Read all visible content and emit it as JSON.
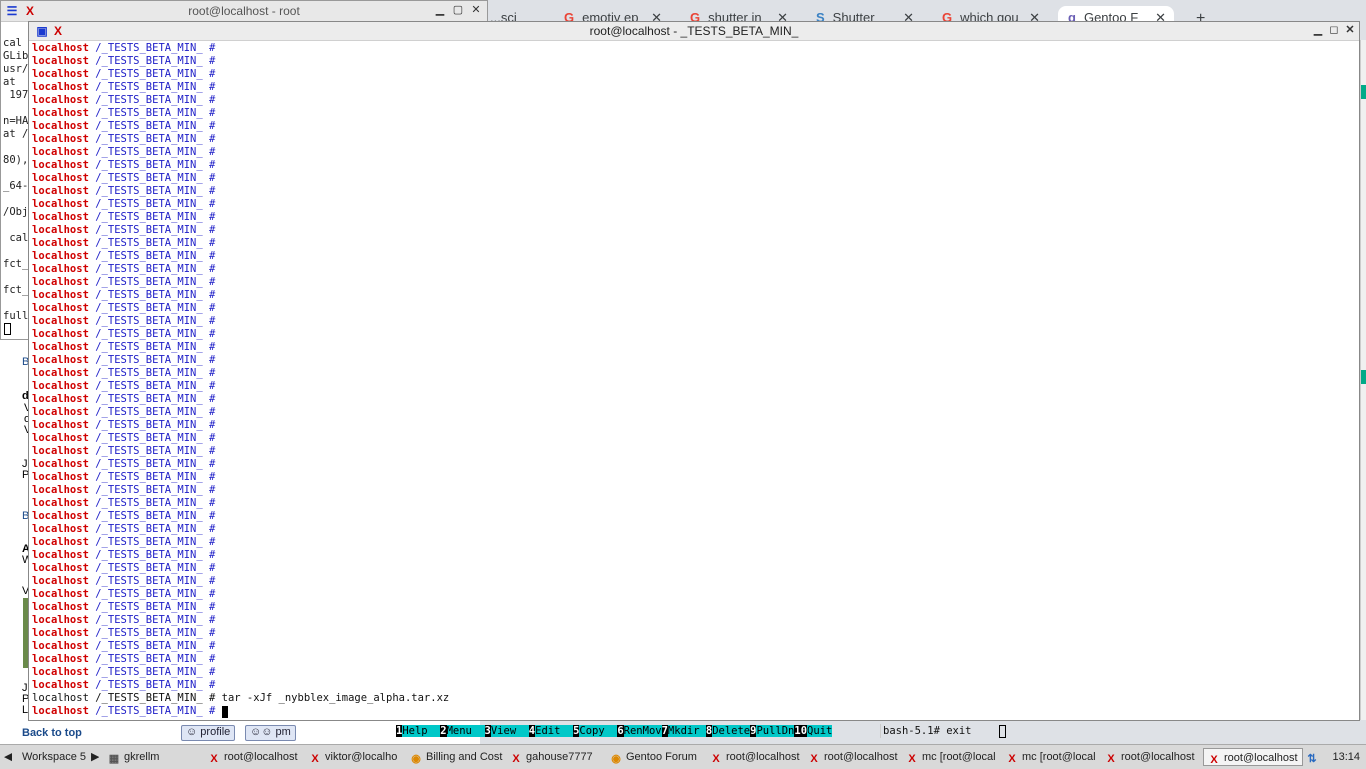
{
  "background_browser": {
    "tabs": [
      {
        "label": "...sci",
        "icon": ""
      },
      {
        "label": "emotiv ep",
        "icon": "G"
      },
      {
        "label": "shutter in",
        "icon": "G"
      },
      {
        "label": "Shutter",
        "icon": "S"
      },
      {
        "label": "which gou",
        "icon": "G"
      },
      {
        "label": "Gentoo F",
        "icon": "g"
      }
    ],
    "new_tab": "+"
  },
  "left_page": {
    "lines": [
      "B",
      "d",
      "V",
      "o",
      "V",
      "J",
      "P",
      "B",
      "A",
      "W",
      "V",
      "J",
      "P",
      "L"
    ],
    "back_to_top": "Back to top",
    "buttons": [
      {
        "label": "profile"
      },
      {
        "label": "pm"
      }
    ]
  },
  "xterm_small": {
    "title": "root@localhost - root",
    "lines": [
      "cal",
      "GLib",
      "usr/",
      "at",
      " 197",
      "",
      "n=HA",
      "at /",
      "",
      "80),",
      "",
      "_64-",
      "",
      "/Obj",
      "",
      " cal",
      "",
      "fct_",
      "",
      "fct_",
      "",
      "full"
    ]
  },
  "xterm_main": {
    "title": "root@localhost - _TESTS_BETA_MIN_",
    "prompt": {
      "host": "localhost",
      "path": "/_TESTS_BETA_MIN_",
      "symbol": "#"
    },
    "repeat_prompt_count": 50,
    "command_line": "localhost /_TESTS_BETA_MIN_ # tar -xJf _nybblex_image_alpha.tar.xz"
  },
  "mc_bar": {
    "keys": [
      {
        "num": "1",
        "label": "Help"
      },
      {
        "num": "2",
        "label": "Menu"
      },
      {
        "num": "3",
        "label": "View"
      },
      {
        "num": "4",
        "label": "Edit"
      },
      {
        "num": "5",
        "label": "Copy"
      },
      {
        "num": "6",
        "label": "RenMov"
      },
      {
        "num": "7",
        "label": "Mkdir"
      },
      {
        "num": "8",
        "label": "Delete"
      },
      {
        "num": "9",
        "label": "PullDn"
      },
      {
        "num": "10",
        "label": "Quit"
      }
    ],
    "bash_line": "bash-5.1# exit"
  },
  "taskbar": {
    "workspace": "Workspace 5",
    "items": [
      {
        "label": "gkrellm",
        "icon": "app-icon"
      },
      {
        "label": "root@localhost",
        "icon": "xterm-icon"
      },
      {
        "label": "viktor@localho",
        "icon": "xterm-icon"
      },
      {
        "label": "Billing and Cost",
        "icon": "chrome-icon"
      },
      {
        "label": "gahouse7777",
        "icon": "xterm-icon"
      },
      {
        "label": "Gentoo Forum",
        "icon": "chrome-icon"
      },
      {
        "label": "root@localhost",
        "icon": "xterm-icon"
      },
      {
        "label": "root@localhost",
        "icon": "xterm-icon"
      },
      {
        "label": "mc [root@local",
        "icon": "xterm-icon"
      },
      {
        "label": "mc [root@local",
        "icon": "xterm-icon"
      },
      {
        "label": "root@localhost",
        "icon": "xterm-icon"
      },
      {
        "label": "root@localhost",
        "icon": "xterm-icon"
      }
    ],
    "clock": "13:14"
  },
  "colors": {
    "host": "#d00000",
    "path": "#2020c8",
    "mc_label_bg": "#00c8c8"
  }
}
